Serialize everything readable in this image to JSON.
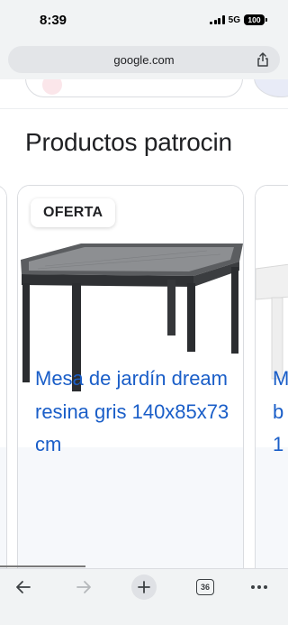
{
  "status_bar": {
    "time": "8:39",
    "network": "5G",
    "battery": "100"
  },
  "url_bar": {
    "url": "google.com",
    "share_icon": "share-icon"
  },
  "search": {
    "section_title": "Productos patrocin"
  },
  "products": [
    {
      "badge": "OFERTA",
      "title": "Mesa de jardín dream resina gris 140x85x73 cm",
      "image": "table-image"
    },
    {
      "title_fragment": "M\nb\n1"
    }
  ],
  "toolbar": {
    "back_icon": "back-arrow-icon",
    "forward_icon": "forward-arrow-icon",
    "new_tab_icon": "plus-icon",
    "tab_count": "36",
    "more_icon": "more-dots-icon"
  },
  "colors": {
    "link_blue": "#1a5ec8",
    "chrome_gray": "#f1f3f4"
  }
}
